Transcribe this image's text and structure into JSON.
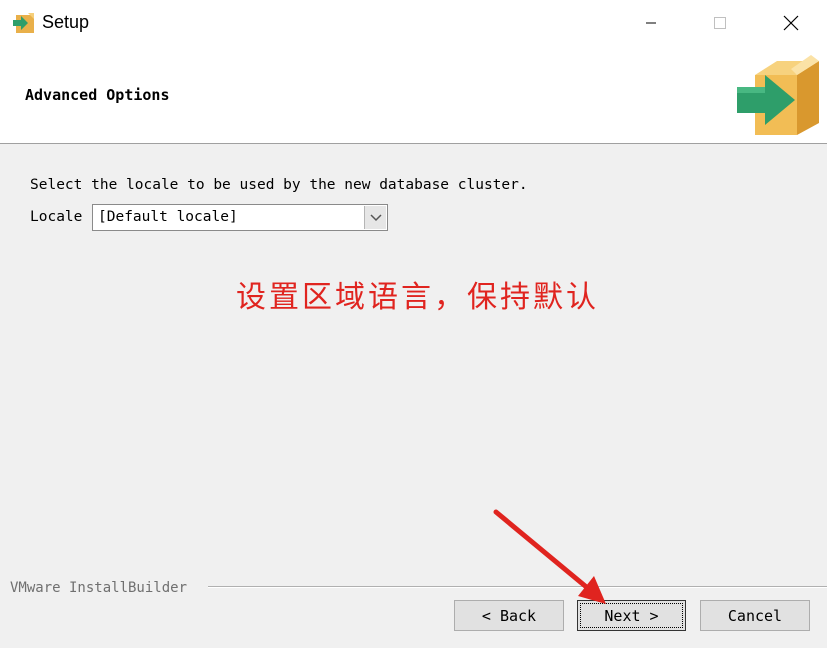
{
  "window": {
    "title": "Setup",
    "icons": [
      "app-icon",
      "minimize-icon",
      "maximize-icon",
      "close-icon"
    ]
  },
  "header": {
    "title": "Advanced Options",
    "logo_icon": "install-box-arrow-icon"
  },
  "content": {
    "prompt": "Select the locale to be used by the new database cluster.",
    "locale_label": "Locale",
    "locale_value": "[Default locale]",
    "annotation": "设置区域语言，保持默认",
    "annotation_color": "#e0241f"
  },
  "footer": {
    "brand": "VMware InstallBuilder",
    "back_label": "< Back",
    "next_label": "Next >",
    "cancel_label": "Cancel"
  }
}
